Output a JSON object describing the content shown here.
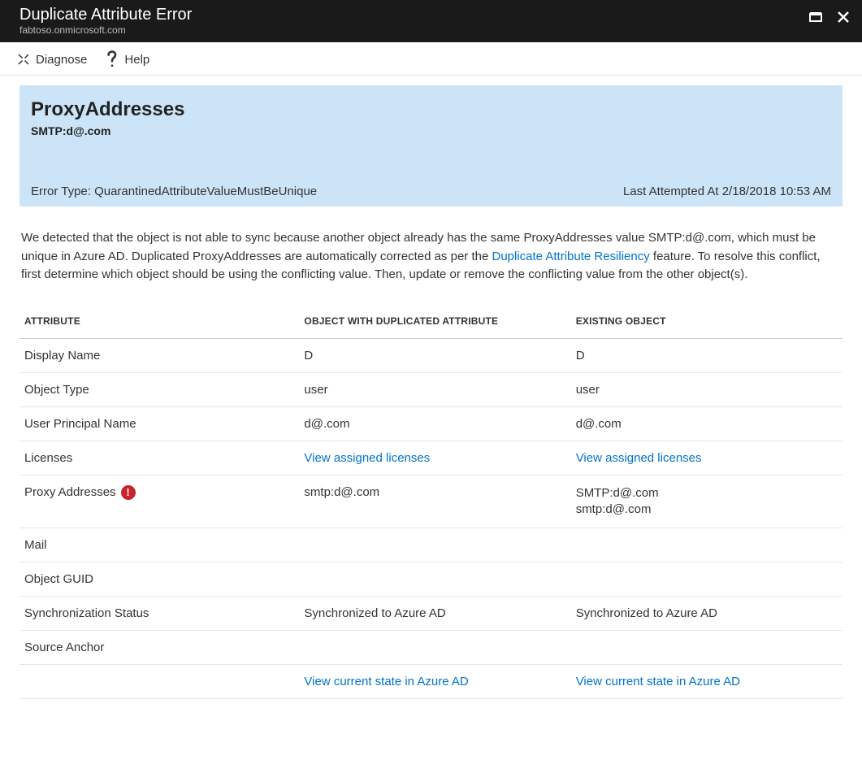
{
  "title": {
    "main": "Duplicate Attribute Error",
    "sub": "fabtoso.onmicrosoft.com"
  },
  "toolbar": {
    "diagnose": "Diagnose",
    "help": "Help"
  },
  "banner": {
    "heading": "ProxyAddresses",
    "subheading": "SMTP:d@.com",
    "errorTypeLabel": "Error Type: QuarantinedAttributeValueMustBeUnique",
    "lastAttempted": "Last Attempted At 2/18/2018 10:53 AM"
  },
  "description": {
    "part1": "We detected that the object is not able to sync because another object already has the same ProxyAddresses value SMTP:d@.com,                    which must be unique in Azure AD. Duplicated ProxyAddresses are automatically corrected as per the ",
    "linkText": "Duplicate Attribute Resiliency",
    "part2": " feature. To resolve this conflict, first determine which object should be using the conflicting value. Then, update or remove the conflicting value from the other object(s)."
  },
  "table": {
    "headers": {
      "attribute": "ATTRIBUTE",
      "duplicated": "OBJECT WITH DUPLICATED ATTRIBUTE",
      "existing": "EXISTING OBJECT"
    },
    "rows": [
      {
        "attr": "Display Name",
        "dup": "D",
        "exist": "D"
      },
      {
        "attr": "Object Type",
        "dup": "user",
        "exist": "user"
      },
      {
        "attr": "User Principal Name",
        "dup": "d@.com",
        "exist": "d@.com"
      },
      {
        "attr": "Licenses",
        "dupLink": "View assigned licenses",
        "existLink": "View assigned licenses"
      },
      {
        "attr": "Proxy Addresses",
        "alert": true,
        "dup": "smtp:d@.com",
        "existMulti": [
          "SMTP:d@.com",
          "smtp:d@.com"
        ]
      },
      {
        "attr": "Mail",
        "dup": "",
        "exist": ""
      },
      {
        "attr": "Object GUID",
        "dup": "",
        "exist": ""
      },
      {
        "attr": "Synchronization Status",
        "dup": "Synchronized to Azure AD",
        "exist": "Synchronized to Azure AD"
      },
      {
        "attr": "Source Anchor",
        "dup": "",
        "exist": ""
      },
      {
        "attr": "",
        "dupLink": "View current state in Azure AD",
        "existLink": "View current state in Azure AD"
      }
    ]
  }
}
